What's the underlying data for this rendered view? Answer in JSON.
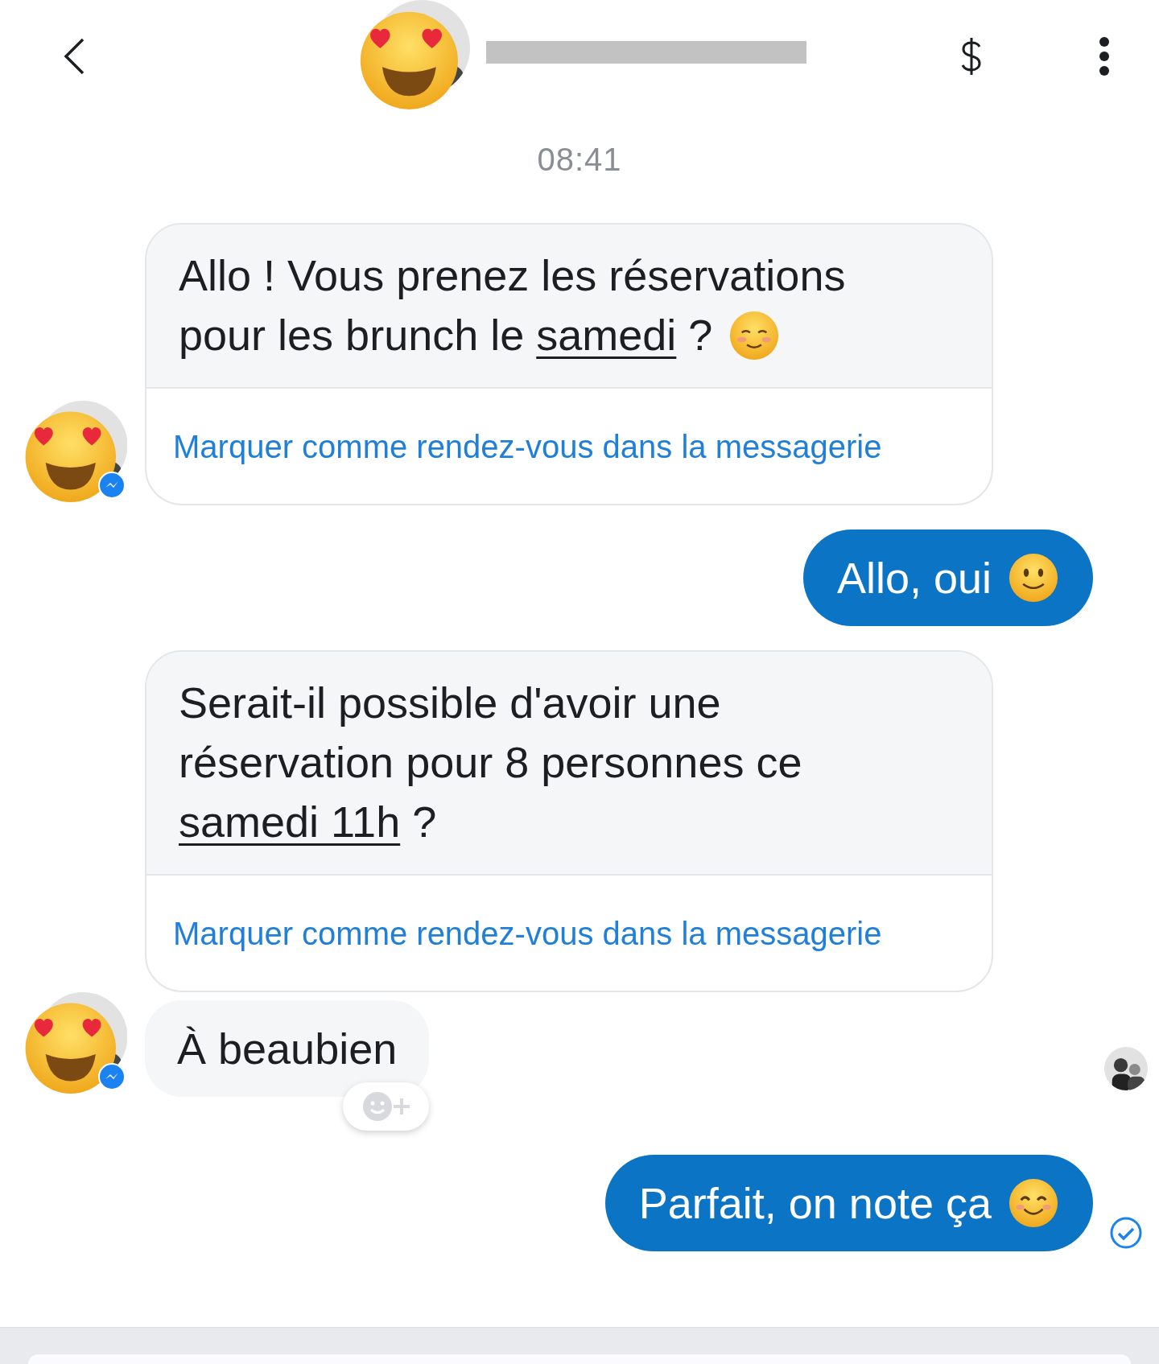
{
  "header": {
    "name_redacted": true
  },
  "timestamp": "08:41",
  "messages": [
    {
      "kind": "received",
      "parts": [
        {
          "text": "Allo ! Vous prenez les réservations\npour les brunch le ",
          "underline": false
        },
        {
          "text": "samedi",
          "underline": true
        },
        {
          "text": " ?",
          "underline": false
        }
      ],
      "emoji": {
        "kind": "blush"
      },
      "action": "Marquer comme rendez-vous dans la messagerie",
      "avatar": true
    },
    {
      "kind": "sent",
      "parts": [
        {
          "text": "Allo, oui",
          "underline": false
        }
      ],
      "emoji": {
        "kind": "smile"
      }
    },
    {
      "kind": "received",
      "parts": [
        {
          "text": "Serait-il possible d'avoir une\nréservation pour 8 personnes ce\n",
          "underline": false
        },
        {
          "text": "samedi 11h",
          "underline": true
        },
        {
          "text": " ?",
          "underline": false
        }
      ],
      "action": "Marquer comme rendez-vous dans la messagerie",
      "avatar": false
    },
    {
      "kind": "received",
      "parts": [
        {
          "text": "À beaubien",
          "underline": false
        }
      ],
      "avatar": true,
      "react_button": true,
      "seen": true
    },
    {
      "kind": "sent",
      "parts": [
        {
          "text": "Parfait, on note ça",
          "underline": false
        }
      ],
      "emoji": {
        "kind": "happy"
      },
      "delivered": true
    }
  ]
}
